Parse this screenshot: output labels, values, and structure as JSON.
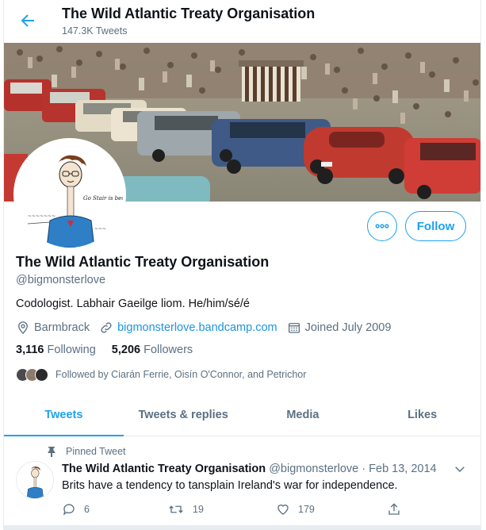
{
  "header": {
    "title": "The Wild Atlantic Treaty Organisation",
    "tweet_count": "147.3K Tweets"
  },
  "profile": {
    "name": "The Wild Atlantic Treaty Organisation",
    "handle": "@bigmonsterlove",
    "bio": "Codologist. Labhair Gaeilge liom. He/him/sé/é",
    "location": "Barmbrack",
    "website": "bigmonsterlove.bandcamp.com",
    "joined": "Joined July 2009",
    "following_count": "3,116",
    "following_label": "Following",
    "followers_count": "5,206",
    "followers_label": "Followers",
    "followed_by": "Followed by Ciarán Ferrie, Oisín O'Connor, and Petrichor",
    "follow_label": "Follow"
  },
  "tabs": [
    {
      "label": "Tweets",
      "active": true
    },
    {
      "label": "Tweets & replies",
      "active": false
    },
    {
      "label": "Media",
      "active": false
    },
    {
      "label": "Likes",
      "active": false
    }
  ],
  "tweet": {
    "pinned_label": "Pinned Tweet",
    "author": "The Wild Atlantic Treaty Organisation",
    "handle": "@bigmonsterlove",
    "date": "Feb 13, 2014",
    "text": "Brits have a tendency to tansplain Ireland's war for independence.",
    "replies": "6",
    "retweets": "19",
    "likes": "179"
  },
  "avatar_caption": "Go Stair is beo...",
  "colors": {
    "accent": "#1da1f2",
    "link": "#1b95e0",
    "secondary_text": "#5b7083"
  }
}
